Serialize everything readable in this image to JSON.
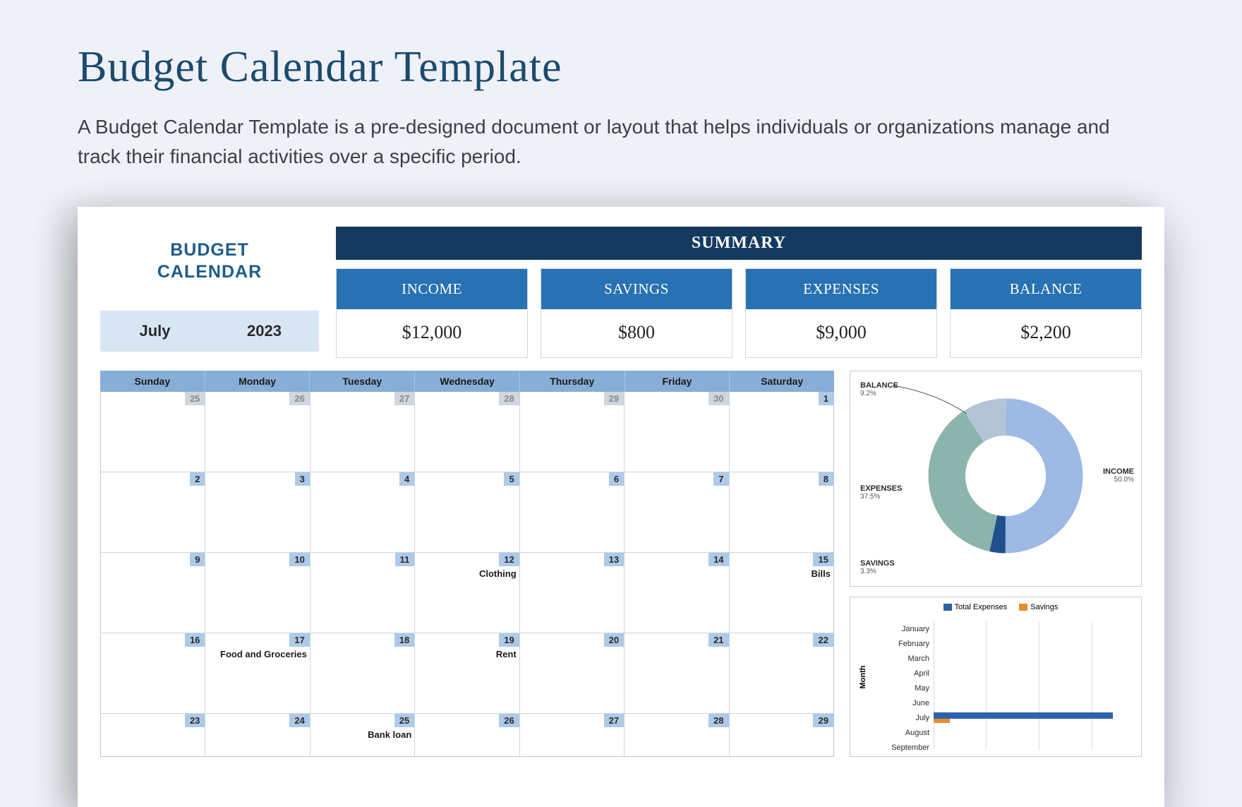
{
  "page": {
    "title": "Budget Calendar Template",
    "description": "A Budget Calendar Template is a pre-designed document or layout that helps individuals or organizations manage and track their financial activities over a specific period."
  },
  "header": {
    "line1": "BUDGET",
    "line2": "CALENDAR",
    "month": "July",
    "year": "2023",
    "summary_label": "SUMMARY"
  },
  "summary": [
    {
      "label": "INCOME",
      "value": "$12,000"
    },
    {
      "label": "SAVINGS",
      "value": "$800"
    },
    {
      "label": "EXPENSES",
      "value": "$9,000"
    },
    {
      "label": "BALANCE",
      "value": "$2,200"
    }
  ],
  "days": [
    "Sunday",
    "Monday",
    "Tuesday",
    "Wednesday",
    "Thursday",
    "Friday",
    "Saturday"
  ],
  "weeks": [
    [
      {
        "n": "25",
        "gray": true
      },
      {
        "n": "26",
        "gray": true
      },
      {
        "n": "27",
        "gray": true
      },
      {
        "n": "28",
        "gray": true
      },
      {
        "n": "29",
        "gray": true
      },
      {
        "n": "30",
        "gray": true
      },
      {
        "n": "1"
      }
    ],
    [
      {
        "n": "2"
      },
      {
        "n": "3"
      },
      {
        "n": "4"
      },
      {
        "n": "5"
      },
      {
        "n": "6"
      },
      {
        "n": "7"
      },
      {
        "n": "8"
      }
    ],
    [
      {
        "n": "9"
      },
      {
        "n": "10"
      },
      {
        "n": "11"
      },
      {
        "n": "12",
        "note": "Clothing"
      },
      {
        "n": "13"
      },
      {
        "n": "14"
      },
      {
        "n": "15",
        "note": "Bills"
      }
    ],
    [
      {
        "n": "16"
      },
      {
        "n": "17",
        "note": "Food and Groceries"
      },
      {
        "n": "18"
      },
      {
        "n": "19",
        "note": "Rent"
      },
      {
        "n": "20"
      },
      {
        "n": "21"
      },
      {
        "n": "22"
      }
    ],
    [
      {
        "n": "23"
      },
      {
        "n": "24"
      },
      {
        "n": "25",
        "note": "Bank loan"
      },
      {
        "n": "26"
      },
      {
        "n": "27"
      },
      {
        "n": "28"
      },
      {
        "n": "29"
      }
    ]
  ],
  "chart_data": [
    {
      "type": "pie",
      "title": "",
      "slices": [
        {
          "name": "INCOME",
          "percent": 50.0,
          "color": "#9db9e4"
        },
        {
          "name": "EXPENSES",
          "percent": 37.5,
          "color": "#8bb4ac"
        },
        {
          "name": "BALANCE",
          "percent": 9.2,
          "color": "#b4c4d6"
        },
        {
          "name": "SAVINGS",
          "percent": 3.3,
          "color": "#1f4f8d"
        }
      ]
    },
    {
      "type": "bar",
      "orientation": "horizontal",
      "ylabel": "Month",
      "categories": [
        "January",
        "February",
        "March",
        "April",
        "May",
        "June",
        "July",
        "August",
        "September"
      ],
      "series": [
        {
          "name": "Total Expenses",
          "color": "#2e62a8",
          "values": [
            0,
            0,
            0,
            0,
            0,
            0,
            9000,
            0,
            0
          ]
        },
        {
          "name": "Savings",
          "color": "#e88b2f",
          "values": [
            0,
            0,
            0,
            0,
            0,
            0,
            800,
            0,
            0
          ]
        }
      ],
      "xlim": [
        0,
        10000
      ]
    }
  ],
  "pie_labels": {
    "balance": "BALANCE",
    "balance_pct": "9.2%",
    "expenses": "EXPENSES",
    "expenses_pct": "37.5%",
    "savings": "SAVINGS",
    "savings_pct": "3.3%",
    "income": "INCOME",
    "income_pct": "50.0%"
  },
  "bar_legend": {
    "a": "Total Expenses",
    "b": "Savings"
  }
}
